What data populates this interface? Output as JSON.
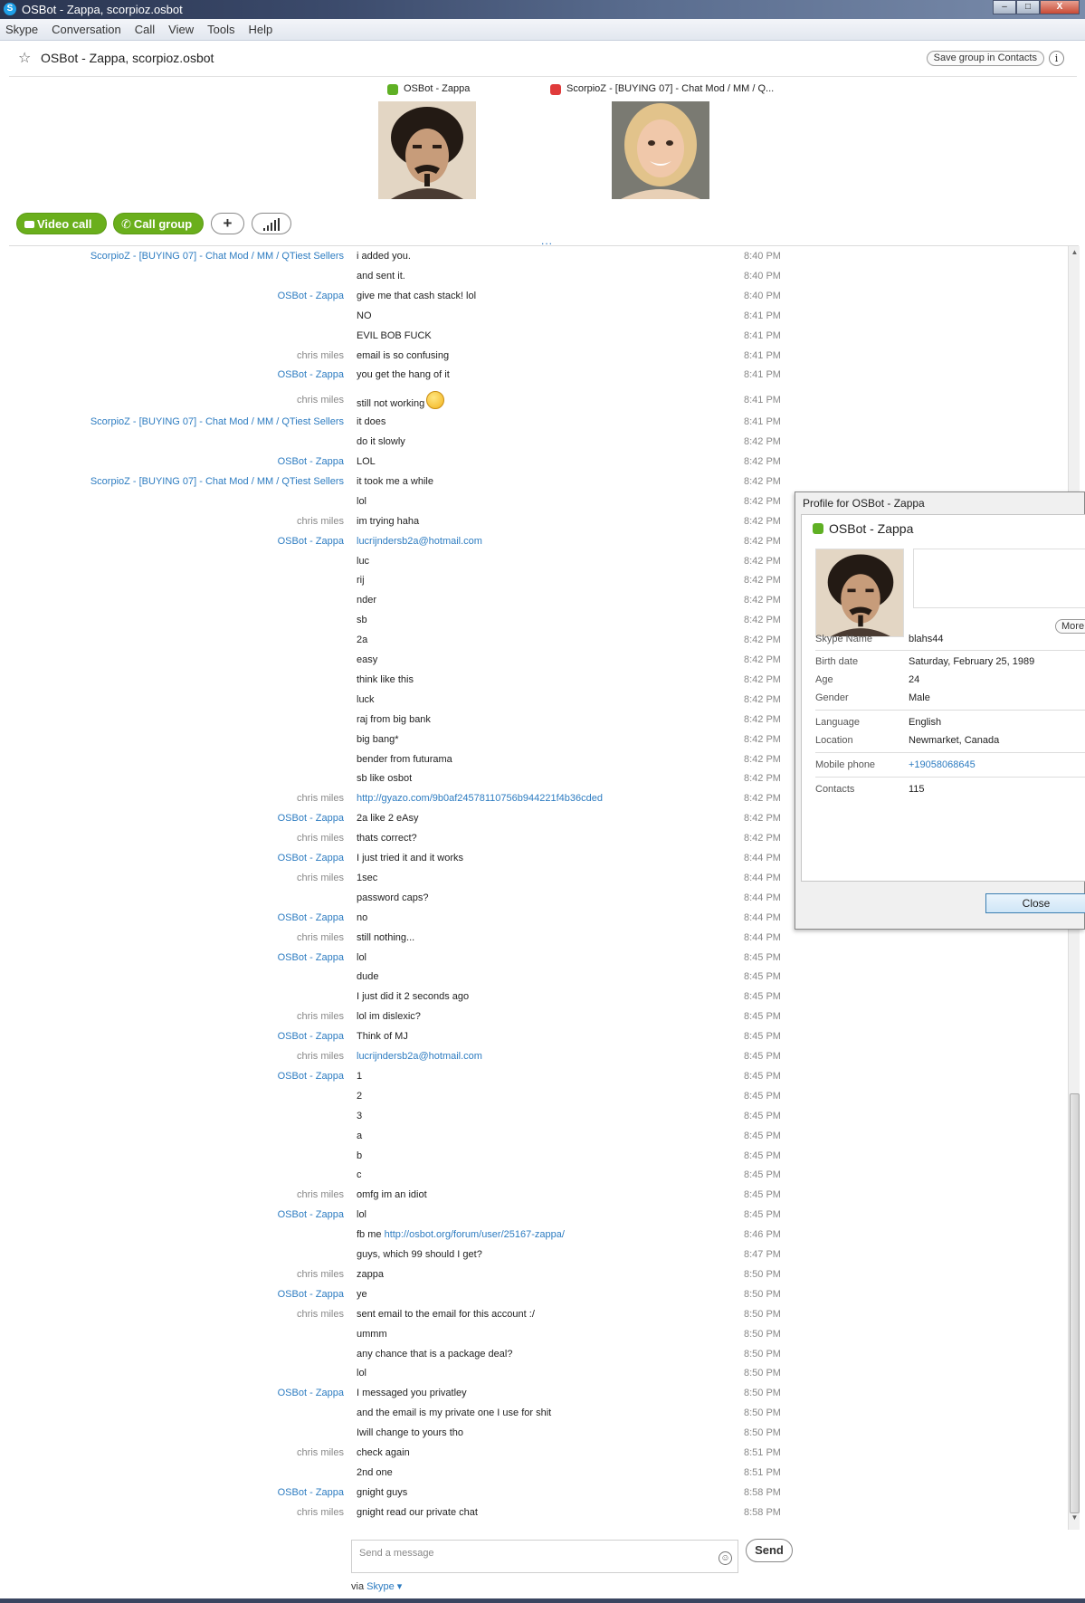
{
  "window": {
    "title": "OSBot - Zappa, scorpioz.osbot",
    "minimize": "–",
    "maximize": "□",
    "close": "X"
  },
  "menu": [
    "Skype",
    "Conversation",
    "Call",
    "View",
    "Tools",
    "Help"
  ],
  "header": {
    "title": "OSBot - Zappa, scorpioz.osbot",
    "save_group": "Save group in Contacts",
    "info": "i"
  },
  "participants": [
    {
      "name": "OSBot - Zappa",
      "status_color": "#5fb024"
    },
    {
      "name": "ScorpioZ - [BUYING 07] - Chat Mod / MM / Q...",
      "status_color": "#e03b3b"
    }
  ],
  "calls": {
    "video_call": "Video call",
    "call_group": "Call group",
    "add": "+",
    "more": "..."
  },
  "colors": {
    "accent_green": "#6aaf1c",
    "link_blue": "#2d7cc1",
    "online_green": "#5fb024",
    "busy_red": "#e03b3b"
  },
  "messages": [
    {
      "sender": "ScorpioZ - [BUYING 07] - Chat Mod / MM / QTiest Sellers",
      "sender_color": "blue",
      "text": "i added you.",
      "time": "8:40 PM"
    },
    {
      "sender": "",
      "text": "and sent it.",
      "time": "8:40 PM"
    },
    {
      "sender": "OSBot - Zappa",
      "sender_color": "blue",
      "text": "give me that cash stack! lol",
      "time": "8:40 PM"
    },
    {
      "sender": "",
      "text": "NO",
      "time": "8:41 PM"
    },
    {
      "sender": "",
      "text": "EVIL BOB FUCK",
      "time": "8:41 PM"
    },
    {
      "sender": "chris miles",
      "sender_color": "gray",
      "text": "email is so confusing",
      "time": "8:41 PM"
    },
    {
      "sender": "OSBot - Zappa",
      "sender_color": "blue",
      "text": "you get the hang of it",
      "time": "8:41 PM"
    },
    {
      "sender": "chris miles",
      "sender_color": "gray",
      "text": "still not working",
      "time": "8:41 PM",
      "emoticon": true
    },
    {
      "sender": "ScorpioZ - [BUYING 07] - Chat Mod / MM / QTiest Sellers",
      "sender_color": "blue",
      "text": "it does",
      "time": "8:41 PM"
    },
    {
      "sender": "",
      "text": "do it slowly",
      "time": "8:42 PM"
    },
    {
      "sender": "OSBot - Zappa",
      "sender_color": "blue",
      "text": "LOL",
      "time": "8:42 PM"
    },
    {
      "sender": "ScorpioZ - [BUYING 07] - Chat Mod / MM / QTiest Sellers",
      "sender_color": "blue",
      "text": "it took me a while",
      "time": "8:42 PM"
    },
    {
      "sender": "",
      "text": "lol",
      "time": "8:42 PM"
    },
    {
      "sender": "chris miles",
      "sender_color": "gray",
      "text": "im trying haha",
      "time": "8:42 PM"
    },
    {
      "sender": "OSBot - Zappa",
      "sender_color": "blue",
      "text": "lucrijndersb2a@hotmail.com",
      "time": "8:42 PM",
      "is_link": true
    },
    {
      "sender": "",
      "text": "luc",
      "time": "8:42 PM"
    },
    {
      "sender": "",
      "text": "rij",
      "time": "8:42 PM"
    },
    {
      "sender": "",
      "text": "nder",
      "time": "8:42 PM"
    },
    {
      "sender": "",
      "text": "sb",
      "time": "8:42 PM"
    },
    {
      "sender": "",
      "text": "2a",
      "time": "8:42 PM"
    },
    {
      "sender": "",
      "text": "easy",
      "time": "8:42 PM"
    },
    {
      "sender": "",
      "text": "think like this",
      "time": "8:42 PM"
    },
    {
      "sender": "",
      "text": "luck",
      "time": "8:42 PM"
    },
    {
      "sender": "",
      "text": "raj from big bank",
      "time": "8:42 PM"
    },
    {
      "sender": "",
      "text": "big bang*",
      "time": "8:42 PM"
    },
    {
      "sender": "",
      "text": "bender from futurama",
      "time": "8:42 PM"
    },
    {
      "sender": "",
      "text": "sb like osbot",
      "time": "8:42 PM"
    },
    {
      "sender": "chris miles",
      "sender_color": "gray",
      "text": "http://gyazo.com/9b0af24578110756b944221f4b36cded",
      "time": "8:42 PM",
      "is_link": true
    },
    {
      "sender": "OSBot - Zappa",
      "sender_color": "blue",
      "text": "2a like 2 eAsy",
      "time": "8:42 PM"
    },
    {
      "sender": "chris miles",
      "sender_color": "gray",
      "text": "thats correct?",
      "time": "8:42 PM"
    },
    {
      "sender": "OSBot - Zappa",
      "sender_color": "blue",
      "text": "I just tried it and it works",
      "time": "8:44 PM"
    },
    {
      "sender": "chris miles",
      "sender_color": "gray",
      "text": "1sec",
      "time": "8:44 PM"
    },
    {
      "sender": "",
      "text": "password caps?",
      "time": "8:44 PM"
    },
    {
      "sender": "OSBot - Zappa",
      "sender_color": "blue",
      "text": "no",
      "time": "8:44 PM"
    },
    {
      "sender": "chris miles",
      "sender_color": "gray",
      "text": "still nothing...",
      "time": "8:44 PM"
    },
    {
      "sender": "OSBot - Zappa",
      "sender_color": "blue",
      "text": "lol",
      "time": "8:45 PM"
    },
    {
      "sender": "",
      "text": "dude",
      "time": "8:45 PM"
    },
    {
      "sender": "",
      "text": "I just did it 2 seconds ago",
      "time": "8:45 PM"
    },
    {
      "sender": "chris miles",
      "sender_color": "gray",
      "text": "lol im dislexic?",
      "time": "8:45 PM"
    },
    {
      "sender": "OSBot - Zappa",
      "sender_color": "blue",
      "text": "Think of MJ",
      "time": "8:45 PM"
    },
    {
      "sender": "chris miles",
      "sender_color": "gray",
      "text": "lucrijndersb2a@hotmail.com",
      "time": "8:45 PM",
      "is_link": true
    },
    {
      "sender": "OSBot - Zappa",
      "sender_color": "blue",
      "text": "1",
      "time": "8:45 PM"
    },
    {
      "sender": "",
      "text": "2",
      "time": "8:45 PM"
    },
    {
      "sender": "",
      "text": "3",
      "time": "8:45 PM"
    },
    {
      "sender": "",
      "text": "a",
      "time": "8:45 PM"
    },
    {
      "sender": "",
      "text": "b",
      "time": "8:45 PM"
    },
    {
      "sender": "",
      "text": "c",
      "time": "8:45 PM"
    },
    {
      "sender": "chris miles",
      "sender_color": "gray",
      "text": "omfg im an idiot",
      "time": "8:45 PM"
    },
    {
      "sender": "OSBot - Zappa",
      "sender_color": "blue",
      "text": "lol",
      "time": "8:45 PM"
    },
    {
      "sender": "",
      "text": "fb me ",
      "link": "http://osbot.org/forum/user/25167-zappa/",
      "time": "8:46 PM"
    },
    {
      "sender": "",
      "text": "guys, which 99 should I get?",
      "time": "8:47 PM"
    },
    {
      "sender": "chris miles",
      "sender_color": "gray",
      "text": "zappa",
      "time": "8:50 PM"
    },
    {
      "sender": "OSBot - Zappa",
      "sender_color": "blue",
      "text": "ye",
      "time": "8:50 PM"
    },
    {
      "sender": "chris miles",
      "sender_color": "gray",
      "text": "sent email to the email for this account :/",
      "time": "8:50 PM"
    },
    {
      "sender": "",
      "text": "ummm",
      "time": "8:50 PM"
    },
    {
      "sender": "",
      "text": "any chance that is a package deal?",
      "time": "8:50 PM"
    },
    {
      "sender": "",
      "text": "lol",
      "time": "8:50 PM"
    },
    {
      "sender": "OSBot - Zappa",
      "sender_color": "blue",
      "text": "I messaged you privatley",
      "time": "8:50 PM"
    },
    {
      "sender": "",
      "text": "and the email is my private one I use for shit",
      "time": "8:50 PM"
    },
    {
      "sender": "",
      "text": "Iwill change to yours tho",
      "time": "8:50 PM"
    },
    {
      "sender": "chris miles",
      "sender_color": "gray",
      "text": "check again",
      "time": "8:51 PM"
    },
    {
      "sender": "",
      "text": "2nd one",
      "time": "8:51 PM"
    },
    {
      "sender": "OSBot - Zappa",
      "sender_color": "blue",
      "text": "gnight guys",
      "time": "8:58 PM"
    },
    {
      "sender": "chris miles",
      "sender_color": "gray",
      "text": "gnight read our private chat",
      "time": "8:58 PM"
    }
  ],
  "compose": {
    "placeholder": "Send a message",
    "send": "Send",
    "via_prefix": "via ",
    "via_link": "Skype ▾"
  },
  "profile": {
    "dialog_title": "Profile for OSBot - Zappa",
    "name": "OSBot - Zappa",
    "more": "More",
    "fields": [
      {
        "key": "Skype Name",
        "value": "blahs44"
      },
      {
        "key": "Birth date",
        "value": "Saturday, February 25, 1989"
      },
      {
        "key": "Age",
        "value": "24"
      },
      {
        "key": "Gender",
        "value": "Male"
      },
      {
        "key": "Language",
        "value": "English"
      },
      {
        "key": "Location",
        "value": "Newmarket, Canada"
      },
      {
        "key": "Mobile phone",
        "value": "+19058068645",
        "is_link": true
      },
      {
        "key": "Contacts",
        "value": "115"
      }
    ],
    "close": "Close"
  }
}
